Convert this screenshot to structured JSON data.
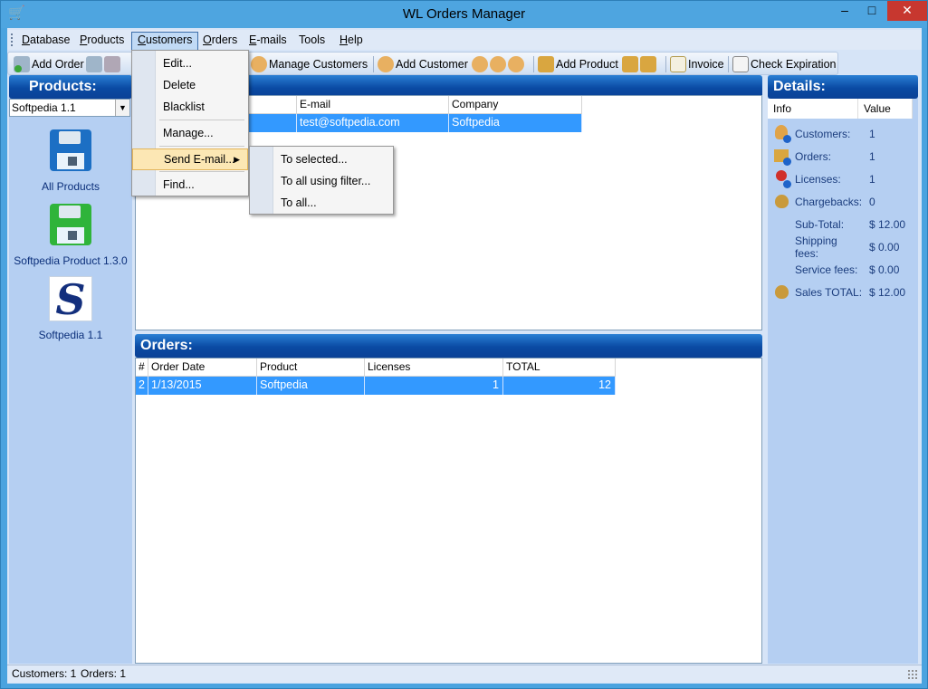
{
  "window": {
    "title": "WL Orders Manager",
    "min": "–",
    "max": "□",
    "close": "✕"
  },
  "menubar": {
    "items": [
      "Database",
      "Products",
      "Customers",
      "Orders",
      "E-mails",
      "Tools",
      "Help"
    ],
    "active": "Customers"
  },
  "toolbar": {
    "add_order": "Add Order",
    "manage_customers": "Manage Customers",
    "add_customer": "Add Customer",
    "add_product": "Add Product",
    "invoice": "Invoice",
    "check_expiration": "Check Expiration"
  },
  "products_panel": {
    "title": "Products:",
    "selected": "Softpedia 1.1",
    "tiles": [
      "All Products",
      "Softpedia Product 1.3.0",
      "Softpedia 1.1"
    ]
  },
  "customers_grid": {
    "columns": [
      "E-mail",
      "Company"
    ],
    "rows": [
      {
        "email": "test@softpedia.com",
        "company": "Softpedia"
      }
    ]
  },
  "orders_panel": {
    "title": "Orders:",
    "columns": [
      "#",
      "Order Date",
      "Product",
      "Licenses",
      "TOTAL"
    ],
    "rows": [
      {
        "id": "2",
        "date": "1/13/2015",
        "product": "Softpedia",
        "licenses": "1",
        "total": "12"
      }
    ]
  },
  "details_panel": {
    "title": "Details:",
    "columns": [
      "Info",
      "Value"
    ],
    "rows": [
      {
        "label": "Customers:",
        "value": "1",
        "icon": "customers-icon"
      },
      {
        "label": "Orders:",
        "value": "1",
        "icon": "orders-icon"
      },
      {
        "label": "Licenses:",
        "value": "1",
        "icon": "licenses-icon"
      },
      {
        "label": "Chargebacks:",
        "value": "0",
        "icon": "chargebacks-icon"
      },
      {
        "label": "Sub-Total:",
        "value": "$ 12.00",
        "icon": ""
      },
      {
        "label": "Shipping fees:",
        "value": "$ 0.00",
        "icon": ""
      },
      {
        "label": "Service fees:",
        "value": "$ 0.00",
        "icon": ""
      },
      {
        "label": "Sales TOTAL:",
        "value": "$ 12.00",
        "icon": "money-bag-icon"
      }
    ]
  },
  "customers_menu": {
    "items": [
      "Edit...",
      "Delete",
      "Blacklist",
      "Manage...",
      "Send E-mail...",
      "Find..."
    ],
    "highlighted": "Send E-mail..."
  },
  "send_email_submenu": {
    "items": [
      "To selected...",
      "To all using filter...",
      "To all..."
    ]
  },
  "statusbar": {
    "customers": "Customers: 1",
    "orders": "Orders: 1"
  },
  "colors": {
    "header_blue": "#0a4aa3",
    "selection": "#3399ff",
    "panel_bg": "#b5cff2",
    "menu_highlight": "#fce7b4"
  }
}
